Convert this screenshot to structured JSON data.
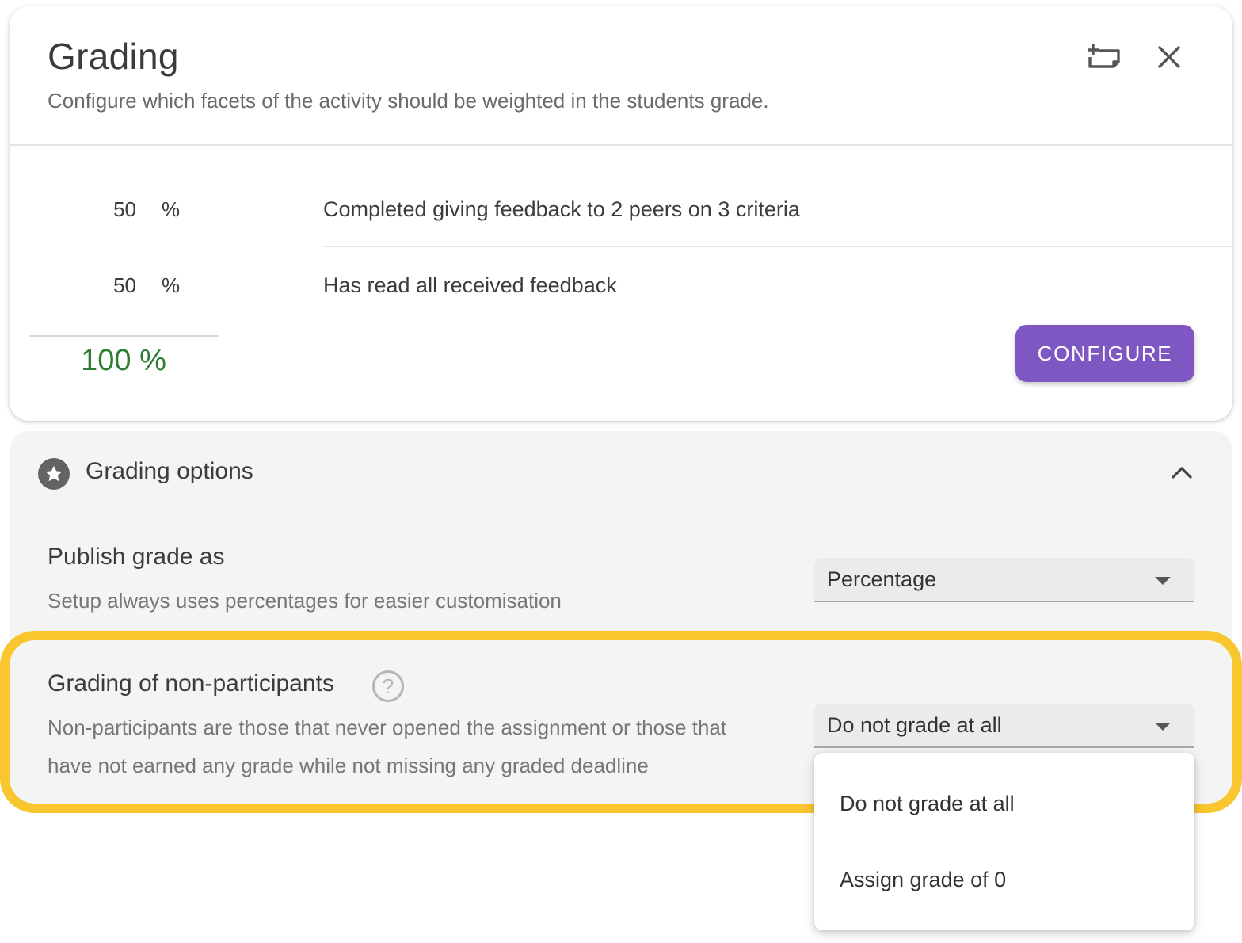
{
  "header": {
    "title": "Grading",
    "subtitle": "Configure which facets of the activity should be weighted in the students grade."
  },
  "weights": [
    {
      "value": "50",
      "unit": "%",
      "label": "Completed giving feedback to 2 peers on 3 criteria"
    },
    {
      "value": "50",
      "unit": "%",
      "label": "Has read all received feedback"
    }
  ],
  "total": "100 %",
  "configure_label": "CONFIGURE",
  "options": {
    "title": "Grading options",
    "publish": {
      "title": "Publish grade as",
      "description": "Setup always uses percentages for easier customisation",
      "selected": "Percentage"
    },
    "non_participants": {
      "title": "Grading of non-participants",
      "help_glyph": "?",
      "description_line1": "Non-participants are those that never opened the assignment or those that",
      "description_line2": "have not earned any grade while not missing any graded deadline",
      "selected": "Do not grade at all",
      "menu_items": [
        "Do not grade at all",
        "Assign grade of 0"
      ]
    }
  },
  "colors": {
    "accent": "#7e57c2",
    "total": "#2e7d32",
    "highlight": "#f9c62f"
  },
  "icons": {
    "add_note": "add-note-icon",
    "close": "close-icon",
    "star": "star-icon",
    "chevron": "chevron-up-icon",
    "help": "help-icon",
    "caret": "caret-down-icon"
  }
}
